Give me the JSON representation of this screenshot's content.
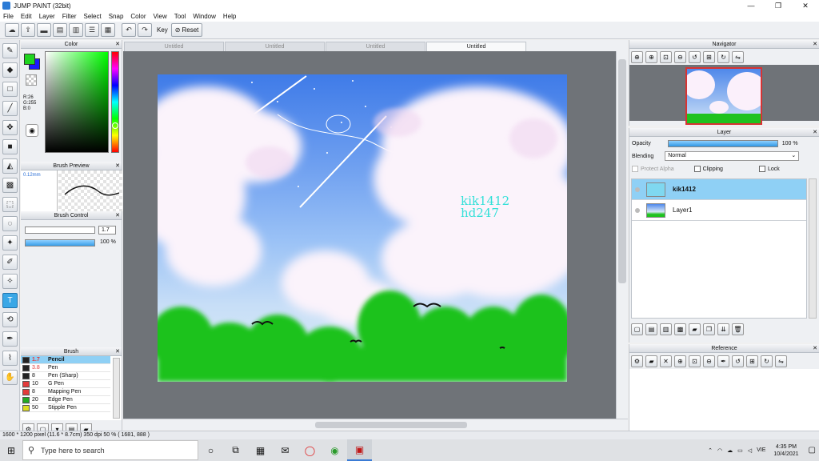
{
  "window": {
    "title": "JUMP PAINT (32bit)",
    "controls": [
      "—",
      "❐",
      "✕"
    ]
  },
  "menu": [
    "File",
    "Edit",
    "Layer",
    "Filter",
    "Select",
    "Snap",
    "Color",
    "View",
    "Tool",
    "Window",
    "Help"
  ],
  "toolbar": {
    "key_label": "Key",
    "reset_label": "Reset"
  },
  "panels": {
    "color": {
      "title": "Color",
      "r": "R:26",
      "g": "G:255",
      "b": "B:0",
      "fg": "#1fd41f",
      "bg": "#1a1aff"
    },
    "brush_preview": {
      "title": "Brush Preview",
      "size": "0.12mm"
    },
    "brush_control": {
      "title": "Brush Control",
      "size_value": "1.7",
      "opacity_value": "100 %"
    },
    "brush": {
      "title": "Brush",
      "items": [
        {
          "size": "1.7",
          "name": "Pencil",
          "color": "#222222",
          "selected": true
        },
        {
          "size": "3.8",
          "name": "Pen",
          "color": "#222222",
          "selected": false
        },
        {
          "size": "8",
          "name": "Pen (Sharp)",
          "color": "#222222",
          "selected": false
        },
        {
          "size": "10",
          "name": "G Pen",
          "color": "#e33a3a",
          "selected": false
        },
        {
          "size": "8",
          "name": "Mapping Pen",
          "color": "#e33a3a",
          "selected": false
        },
        {
          "size": "20",
          "name": "Edge Pen",
          "color": "#22aa22",
          "selected": false
        },
        {
          "size": "50",
          "name": "Stipple Pen",
          "color": "#dddd22",
          "selected": false
        }
      ]
    },
    "navigator": {
      "title": "Navigator"
    },
    "layer": {
      "title": "Layer",
      "opacity_label": "Opacity",
      "opacity_value": "100 %",
      "opacity_fraction": 1.0,
      "blending_label": "Blending",
      "blending_value": "Normal",
      "protect_alpha": "Protect Alpha",
      "clipping": "Clipping",
      "lock": "Lock",
      "layers": [
        {
          "name": "kik1412",
          "selected": true
        },
        {
          "name": "Layer1",
          "selected": false
        }
      ]
    },
    "reference": {
      "title": "Reference"
    }
  },
  "document_tabs": [
    "Untitled",
    "Untitled",
    "Untitled",
    "Untitled"
  ],
  "canvas": {
    "watermark_line1": "kik1412",
    "watermark_line2": "hd247"
  },
  "status": "1600 * 1200 pixel  (11.6 * 8.7cm)  350 dpi  50 %  ( 1681, 888 )",
  "taskbar": {
    "search_placeholder": "Type here to search",
    "language": "VIE",
    "time": "4:35 PM",
    "date": "10/4/2021"
  }
}
